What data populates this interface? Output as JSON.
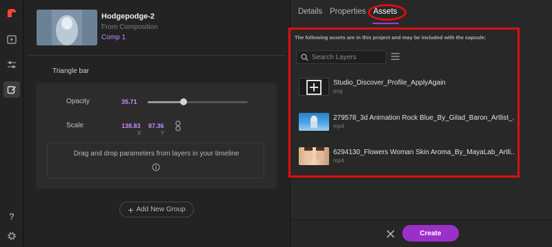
{
  "composition": {
    "title": "Hodgepodge-2",
    "subtitle": "From Composition",
    "comp_name": "Comp 1"
  },
  "group": {
    "title": "Triangle bar",
    "opacity": {
      "label": "Opacity",
      "value": "35.71",
      "level": 0.36
    },
    "scale": {
      "label": "Scale",
      "x": "138.83",
      "y": "87.36",
      "x_axis": "X",
      "y_axis": "Y"
    },
    "drop_text": "Drag and drop parameters from layers in your timeline"
  },
  "add_group_label": "Add New Group",
  "tabs": [
    {
      "label": "Details",
      "active": false
    },
    {
      "label": "Properties",
      "active": false
    },
    {
      "label": "Assets",
      "active": true
    }
  ],
  "assets": {
    "notice": "The following assets are in this project and may be included with the capsule:",
    "search_placeholder": "Search Layers",
    "items": [
      {
        "name": "Studio_Discover_Profile_ApplyAgain",
        "type": "png"
      },
      {
        "name": "279578_3d Animation Rock Blue_By_Gilad_Baron_Artlist_...",
        "type": "mp4"
      },
      {
        "name": "6294130_Flowers Woman Skin Aroma_By_MayaLab_Artli...",
        "type": "mp4"
      }
    ]
  },
  "footer": {
    "create_label": "Create"
  },
  "colors": {
    "accent": "#9b2fc9",
    "highlight_red": "#e20e0e",
    "value_purple": "#c78aff"
  },
  "rail_icons": [
    "app-logo-icon",
    "play-media-icon",
    "sliders-icon",
    "edit-layers-icon",
    "help-icon",
    "settings-gear-icon"
  ]
}
